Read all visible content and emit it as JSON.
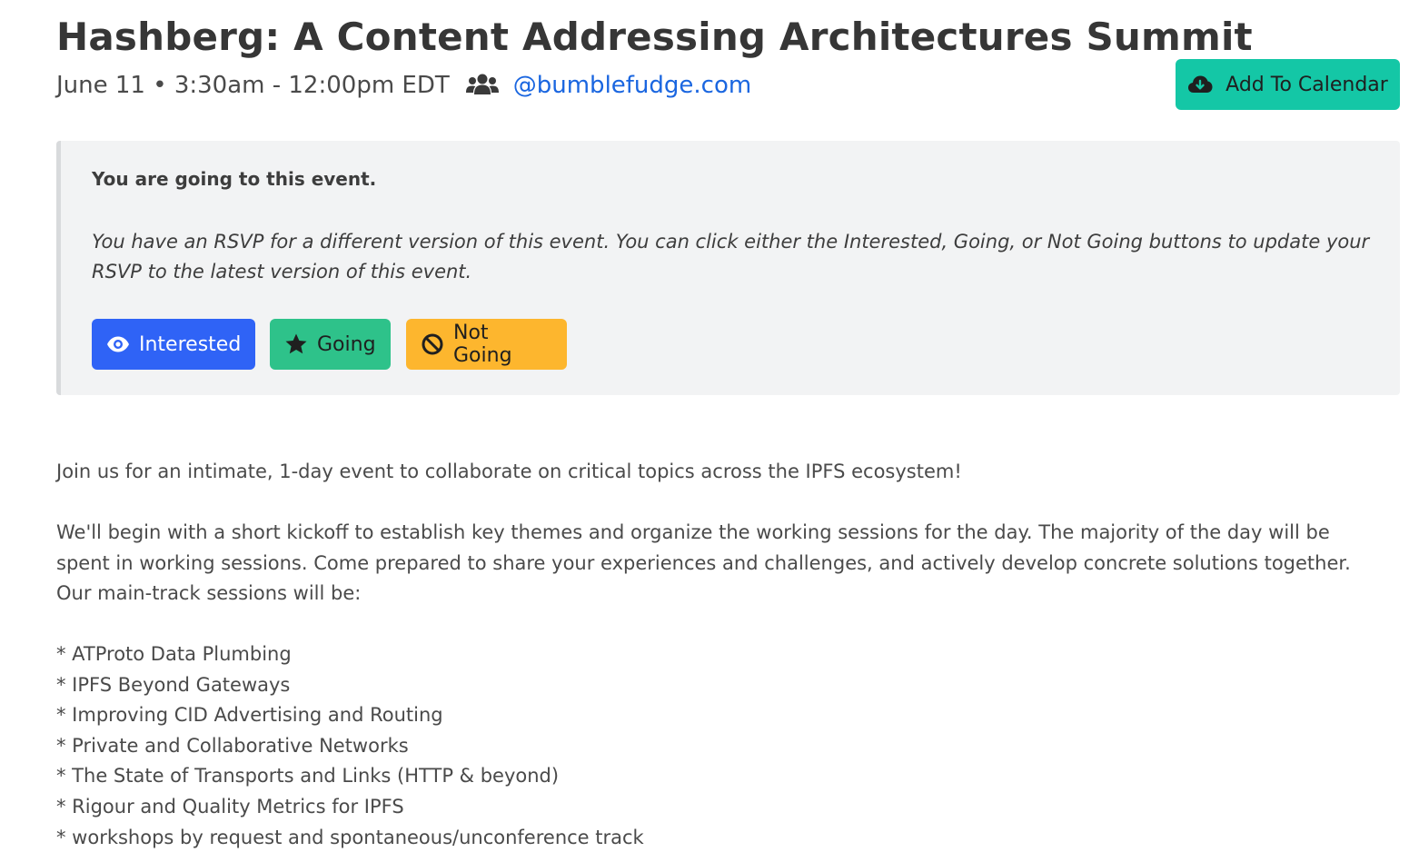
{
  "event": {
    "title": "Hashberg: A Content Addressing Architectures Summit",
    "when": "June 11 • 3:30am - 12:00pm EDT",
    "organizer": "@bumblefudge.com",
    "add_to_calendar_label": "Add To Calendar"
  },
  "rsvp": {
    "status": "You are going to this event.",
    "note": "You have an RSVP for a different version of this event. You can click either the Interested, Going, or Not Going buttons to update your RSVP to the latest version of this event.",
    "buttons": {
      "interested": "Interested",
      "going": "Going",
      "not_going": "Not Going"
    }
  },
  "description": {
    "intro": "Join us for an intimate, 1-day event to collaborate on critical topics across the IPFS ecosystem!",
    "body": "We'll begin with a short kickoff to establish key themes and organize the working sessions for the day. The majority of the day will be spent in working sessions. Come prepared to share your experiences and challenges, and actively develop concrete solutions together. Our main-track sessions will be:",
    "sessions": [
      "* ATProto Data Plumbing",
      "* IPFS Beyond Gateways",
      "* Improving CID Advertising and Routing",
      "* Private and Collaborative Networks",
      "* The State of Transports and Links (HTTP & beyond)",
      "* Rigour and Quality Metrics for IPFS",
      "* workshops by request and spontaneous/unconference track"
    ]
  },
  "icons": {
    "attendees": "users-icon",
    "calendar": "cloud-download-icon",
    "interested": "eye-icon",
    "going": "star-icon",
    "not_going": "ban-icon"
  },
  "colors": {
    "calendar_button": "#14c7a6",
    "interested_button": "#2f63f6",
    "going_button": "#2ec28a",
    "not_going_button": "#fdb62e",
    "link": "#1a66e0"
  }
}
